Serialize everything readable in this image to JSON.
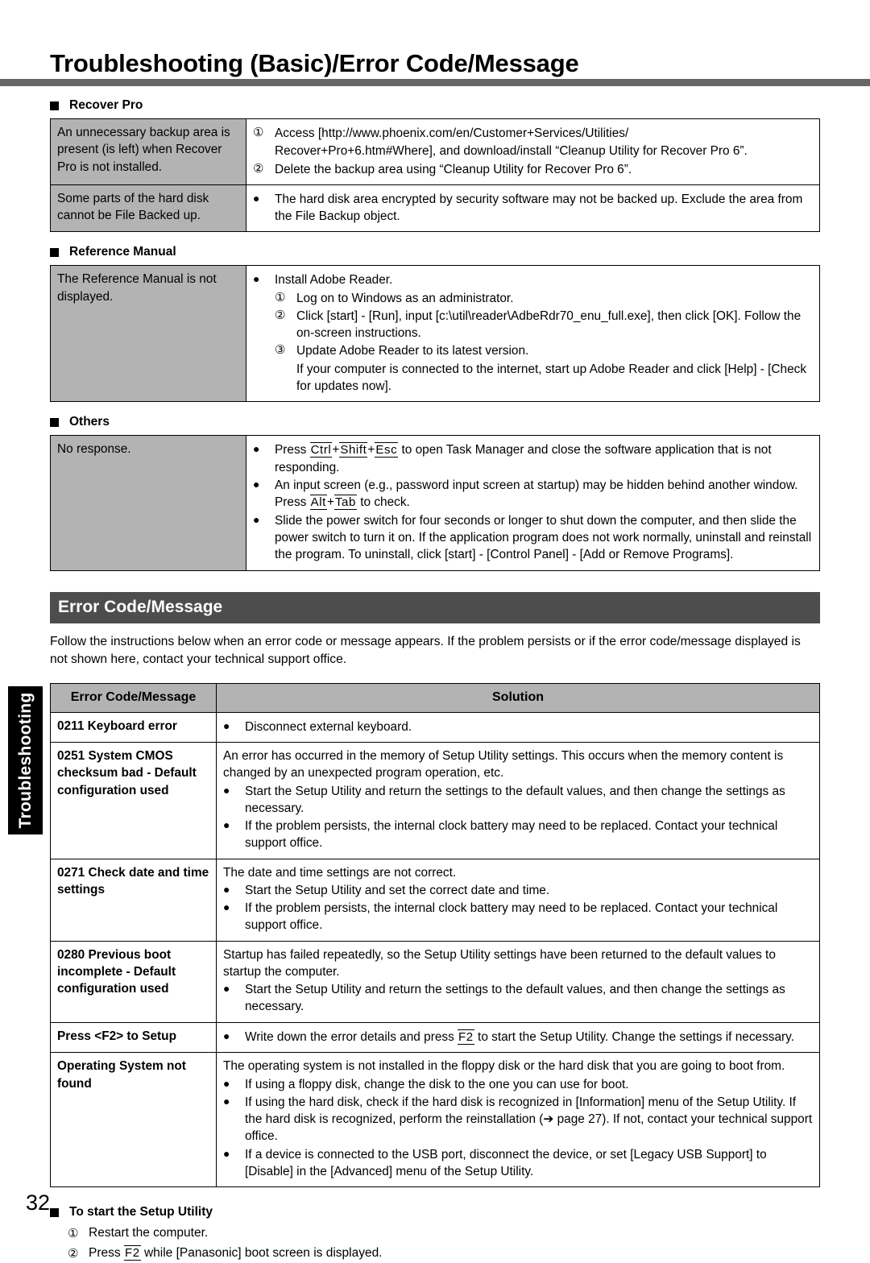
{
  "page": {
    "title": "Troubleshooting (Basic)/Error Code/Message",
    "number": "32",
    "side_tab": "Troubleshooting",
    "accent_rule_color": "#666666",
    "banner_color": "#4d4d4d",
    "label_cell_color": "#b3b3b3"
  },
  "sections": [
    {
      "heading": "Recover Pro",
      "rows": [
        {
          "label": "An unnecessary backup area is present (is left) when Recover Pro is not installed.",
          "items": [
            {
              "marker": "①",
              "text": "Access [http://www.phoenix.com/en/Customer+Services/Utilities/"
            },
            {
              "marker": "",
              "text": "Recover+Pro+6.htm#Where], and download/install “Cleanup Utility for Recover Pro 6”."
            },
            {
              "marker": "②",
              "text": "Delete the backup area using “Cleanup Utility for Recover Pro 6”."
            }
          ]
        },
        {
          "label": "Some parts of the hard disk cannot be File Backed up.",
          "items": [
            {
              "marker": "●",
              "text": "The hard disk area encrypted by security software may not be backed up. Exclude the area from the File Backup object."
            }
          ]
        }
      ]
    },
    {
      "heading": "Reference Manual",
      "rows": [
        {
          "label": "The Reference Manual is not displayed.",
          "items": [
            {
              "marker": "●",
              "text": "Install Adobe Reader."
            },
            {
              "marker": "①",
              "text": "Log on to Windows as an administrator."
            },
            {
              "marker": "②",
              "text": "Click [start] - [Run], input [c:\\util\\reader\\AdbeRdr70_enu_full.exe], then click [OK]. Follow the on-screen instructions."
            },
            {
              "marker": "③",
              "text": "Update Adobe Reader to its latest version."
            },
            {
              "marker": "",
              "text": "If your computer is connected to the internet, start up Adobe Reader and click [Help] - [Check for updates now]."
            }
          ]
        }
      ]
    },
    {
      "heading": "Others",
      "rows": [
        {
          "label": "No response.",
          "items": [
            {
              "marker": "●",
              "text": "Press Ctrl+Shift+Esc to open Task Manager and close the software application that is not responding.",
              "keys": [
                "Ctrl",
                "Shift",
                "Esc"
              ]
            },
            {
              "marker": "●",
              "text": "An input screen (e.g., password input screen at startup) may be hidden behind another window. Press Alt+Tab to check.",
              "keys": [
                "Alt",
                "Tab"
              ]
            },
            {
              "marker": "●",
              "text": "Slide the power switch for four seconds or longer to shut down the computer, and then slide the power switch to turn it on. If the application program does not work normally, uninstall and reinstall the program. To uninstall, click [start] - [Control Panel] - [Add or Remove Programs]."
            }
          ]
        }
      ]
    }
  ],
  "error_section": {
    "banner": "Error Code/Message",
    "intro": "Follow the instructions below when an error code or message appears. If the problem persists or if the error code/message displayed is not shown here, contact your technical support office.",
    "columns": [
      "Error Code/Message",
      "Solution"
    ],
    "rows": [
      {
        "code": "0211 Keyboard error",
        "items": [
          {
            "marker": "●",
            "text": "Disconnect external keyboard."
          }
        ]
      },
      {
        "code": "0251 System CMOS checksum bad - Default configuration used",
        "items": [
          {
            "marker": "",
            "text": "An error has occurred in the memory of Setup Utility settings. This occurs when the memory content is changed by an unexpected program operation, etc."
          },
          {
            "marker": "●",
            "text": "Start the Setup Utility and return the settings to the default values, and then change the settings as necessary."
          },
          {
            "marker": "●",
            "text": "If the problem persists, the internal clock battery may need to be replaced. Contact your technical support office."
          }
        ]
      },
      {
        "code": "0271 Check date and time settings",
        "items": [
          {
            "marker": "",
            "text": "The date and time settings are not correct."
          },
          {
            "marker": "●",
            "text": "Start the Setup Utility and set the correct date and time."
          },
          {
            "marker": "●",
            "text": "If the problem persists, the internal clock battery may need to be replaced. Contact your technical support office."
          }
        ]
      },
      {
        "code": "0280 Previous boot incomplete - Default configuration used",
        "items": [
          {
            "marker": "",
            "text": "Startup has failed repeatedly, so the Setup Utility settings have been returned to the default values to startup the computer."
          },
          {
            "marker": "●",
            "text": "Start the Setup Utility and return the settings to the default values, and then change the settings as necessary."
          }
        ]
      },
      {
        "code": "Press <F2> to Setup",
        "items": [
          {
            "marker": "●",
            "text": "Write down the error details and press F2 to start the Setup Utility. Change the settings if necessary.",
            "keys": [
              "F2"
            ]
          }
        ]
      },
      {
        "code": "Operating System not found",
        "items": [
          {
            "marker": "",
            "text": "The operating system is not installed in the floppy disk or the hard disk that you are going to boot from."
          },
          {
            "marker": "●",
            "text": "If using a floppy disk, change the disk to the one you can use for boot."
          },
          {
            "marker": "●",
            "text": "If using the hard disk, check if the hard disk is recognized in [Information] menu of the Setup Utility. If the hard disk is recognized, perform the reinstallation (➔ page 27). If not, contact your technical support office."
          },
          {
            "marker": "●",
            "text": "If a device is connected to the USB port, disconnect the device, or set [Legacy USB Support] to [Disable] in the [Advanced] menu of the Setup Utility."
          }
        ]
      }
    ]
  },
  "footer": {
    "heading": "To start the Setup Utility",
    "steps": [
      {
        "marker": "①",
        "text": "Restart the computer."
      },
      {
        "marker": "②",
        "text": "Press F2 while [Panasonic] boot screen is displayed.",
        "keys": [
          "F2"
        ]
      }
    ]
  }
}
